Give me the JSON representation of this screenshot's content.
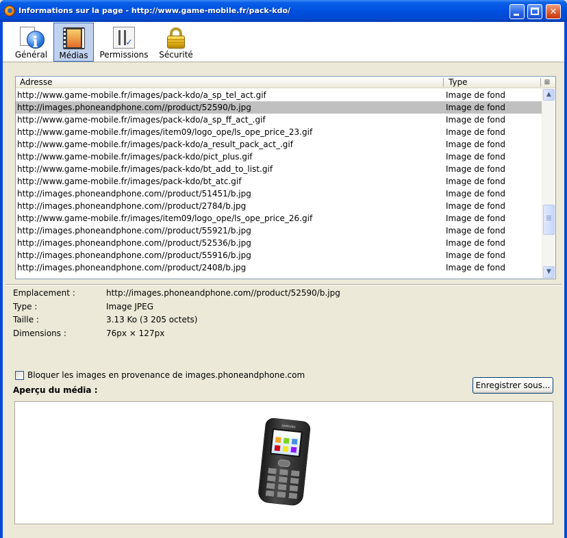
{
  "window": {
    "title": "Informations sur la page - http://www.game-mobile.fr/pack-kdo/"
  },
  "toolbar": {
    "tabs": [
      {
        "label": "Général",
        "icon": "info-icon",
        "selected": false
      },
      {
        "label": "Médias",
        "icon": "film-icon",
        "selected": true
      },
      {
        "label": "Permissions",
        "icon": "permissions-icon",
        "selected": false
      },
      {
        "label": "Sécurité",
        "icon": "lock-icon",
        "selected": false
      }
    ]
  },
  "media_list": {
    "columns": {
      "address": "Adresse",
      "type": "Type"
    },
    "rows": [
      {
        "address": "http://www.game-mobile.fr/images/pack-kdo/a_sp_tel_act.gif",
        "type": "Image de fond"
      },
      {
        "address": "http://images.phoneandphone.com//product/52590/b.jpg",
        "type": "Image de fond"
      },
      {
        "address": "http://www.game-mobile.fr/images/pack-kdo/a_sp_ff_act_.gif",
        "type": "Image de fond"
      },
      {
        "address": "http://www.game-mobile.fr/images/item09/logo_ope/ls_ope_price_23.gif",
        "type": "Image de fond"
      },
      {
        "address": "http://www.game-mobile.fr/images/pack-kdo/a_result_pack_act_.gif",
        "type": "Image de fond"
      },
      {
        "address": "http://www.game-mobile.fr/images/pack-kdo/pict_plus.gif",
        "type": "Image de fond"
      },
      {
        "address": "http://www.game-mobile.fr/images/pack-kdo/bt_add_to_list.gif",
        "type": "Image de fond"
      },
      {
        "address": "http://www.game-mobile.fr/images/pack-kdo/bt_atc.gif",
        "type": "Image de fond"
      },
      {
        "address": "http://images.phoneandphone.com//product/51451/b.jpg",
        "type": "Image de fond"
      },
      {
        "address": "http://images.phoneandphone.com//product/2784/b.jpg",
        "type": "Image de fond"
      },
      {
        "address": "http://www.game-mobile.fr/images/item09/logo_ope/ls_ope_price_26.gif",
        "type": "Image de fond"
      },
      {
        "address": "http://images.phoneandphone.com//product/55921/b.jpg",
        "type": "Image de fond"
      },
      {
        "address": "http://images.phoneandphone.com//product/52536/b.jpg",
        "type": "Image de fond"
      },
      {
        "address": "http://images.phoneandphone.com//product/55916/b.jpg",
        "type": "Image de fond"
      },
      {
        "address": "http://images.phoneandphone.com//product/2408/b.jpg",
        "type": "Image de fond"
      }
    ],
    "selected_index": 1
  },
  "details": {
    "location_label": "Emplacement :",
    "location_value": "http://images.phoneandphone.com//product/52590/b.jpg",
    "type_label": "Type :",
    "type_value": "Image JPEG",
    "size_label": "Taille :",
    "size_value": "3.13 Ko (3 205 octets)",
    "dimensions_label": "Dimensions :",
    "dimensions_value": "76px × 127px"
  },
  "block_checkbox": {
    "label": "Bloquer les images en provenance de images.phoneandphone.com",
    "checked": false
  },
  "save_button": "Enregistrer sous...",
  "preview_title": "Aperçu du média :",
  "preview_image": {
    "brand": "SAMSUNG"
  }
}
